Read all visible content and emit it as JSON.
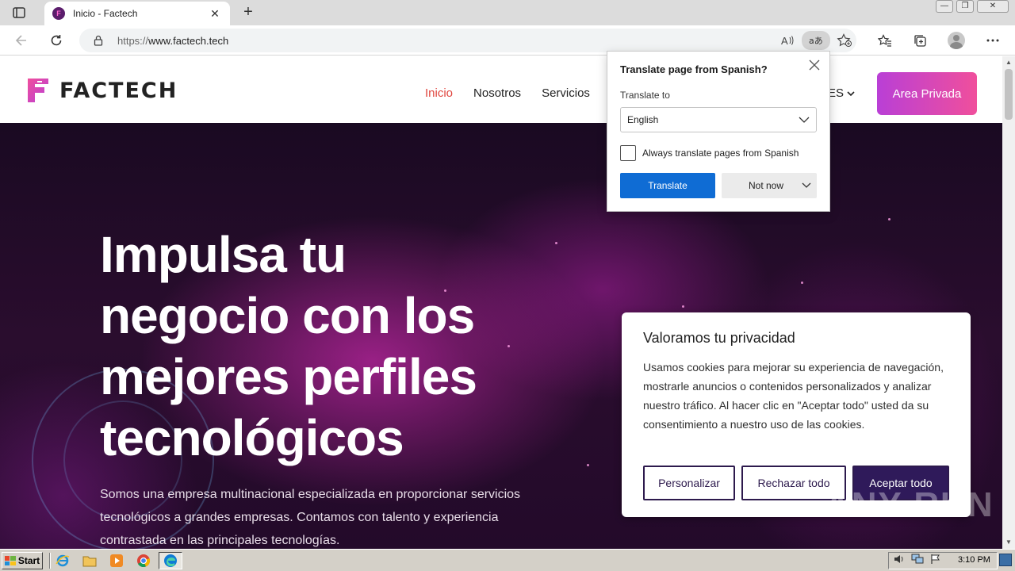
{
  "browser": {
    "tab_title": "Inicio - Factech",
    "favicon_letter": "F",
    "url_prefix": "https://",
    "url_host": "www.factech.tech",
    "win_minimize": "—",
    "win_restore": "❐",
    "win_close": "✕"
  },
  "site": {
    "logo_text": "FACTECH",
    "nav": [
      "Inicio",
      "Nosotros",
      "Servicios"
    ],
    "lang_label": "ES",
    "private_area": "Area Privada"
  },
  "hero": {
    "line1": "Impulsa tu",
    "line2_bold": "negocio",
    "line2_rest": " con los",
    "line3": "mejores perfiles",
    "line4": "tecnológicos",
    "description": "Somos una empresa multinacional especializada en proporcionar servicios tecnológicos a grandes empresas. Contamos con talento y experiencia contrastada en las principales tecnologías."
  },
  "cookie": {
    "title": "Valoramos tu privacidad",
    "text": "Usamos cookies para mejorar su experiencia de navegación, mostrarle anuncios o contenidos personalizados y analizar nuestro tráfico. Al hacer clic en \"Aceptar todo\" usted da su consentimiento a nuestro uso de las cookies.",
    "customize": "Personalizar",
    "reject": "Rechazar todo",
    "accept": "Aceptar todo"
  },
  "translate": {
    "title": "Translate page from Spanish?",
    "translate_to_label": "Translate to",
    "selected_language": "English",
    "always_label": "Always translate pages from Spanish",
    "always_checked": false,
    "translate_button": "Translate",
    "not_now_button": "Not now"
  },
  "watermark": "ANY RUN",
  "taskbar": {
    "start_label": "Start",
    "clock": "3:10 PM"
  },
  "colors": {
    "brand_pink": "#f04f9c",
    "brand_purple": "#b93fd6",
    "nav_active": "#e0463f",
    "accept_button": "#2f1a5a",
    "translate_button": "#0f6cd4"
  }
}
